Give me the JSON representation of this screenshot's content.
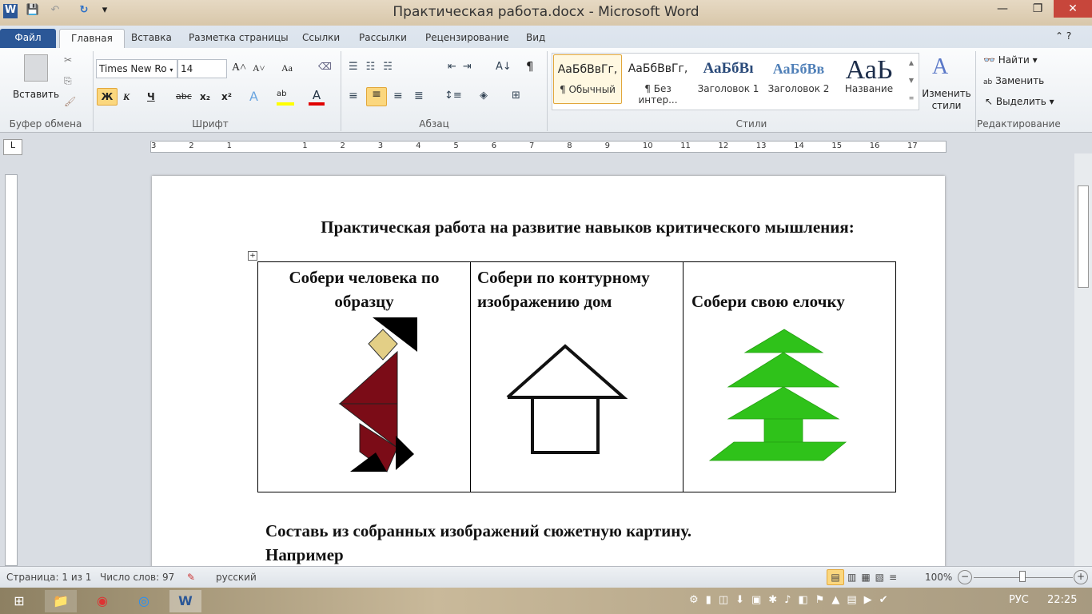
{
  "window": {
    "title": "Практическая работа.docx - Microsoft Word",
    "min": "—",
    "max": "❐",
    "close": "✕"
  },
  "quick_access": {
    "word_icon": "W",
    "save": "💾",
    "undo": "↶",
    "redo": "↻",
    "customize": "▾"
  },
  "tabs": [
    "Файл",
    "Главная",
    "Вставка",
    "Разметка страницы",
    "Ссылки",
    "Рассылки",
    "Рецензирование",
    "Вид"
  ],
  "ribbon": {
    "clipboard": {
      "paste": "Вставить",
      "label": "Буфер обмена"
    },
    "font": {
      "name": "Times New Ro",
      "size": "14",
      "bold": "Ж",
      "italic": "К",
      "underline": "Ч",
      "strike": "abc",
      "sub": "x₂",
      "sup": "x²",
      "grow": "A˄",
      "shrink": "A˅",
      "case": "Aa",
      "label": "Шрифт",
      "highlight_color": "#ffff00",
      "font_color": "#e00000"
    },
    "paragraph": {
      "label": "Абзац",
      "pilcrow": "¶"
    },
    "styles": {
      "label": "Стили",
      "items": [
        {
          "preview": "АаБбВвГг,",
          "name": "¶ Обычный"
        },
        {
          "preview": "АаБбВвГг,",
          "name": "¶ Без интер..."
        },
        {
          "preview": "АаБбВı",
          "name": "Заголовок 1"
        },
        {
          "preview": "АаБбВв",
          "name": "Заголовок 2"
        },
        {
          "preview": "АаЬ",
          "name": "Название"
        }
      ],
      "change": "Изменить стили"
    },
    "editing": {
      "label": "Редактирование",
      "find": "Найти",
      "replace": "Заменить",
      "select": "Выделить"
    }
  },
  "ruler": {
    "ticks": [
      "3",
      "2",
      "1",
      "",
      "1",
      "2",
      "3",
      "4",
      "5",
      "6",
      "7",
      "8",
      "9",
      "10",
      "11",
      "12",
      "13",
      "14",
      "15",
      "16",
      "17"
    ]
  },
  "document": {
    "heading": "Практическая работа на развитие навыков критического мышления:",
    "cells": [
      "Собери человека по образцу",
      "Собери по контурному изображению  дом",
      "Собери свою елочку"
    ],
    "para1": "Составь из собранных изображений сюжетную картину.",
    "para2": "Например",
    "colors": {
      "figure_body": "#7b0c17",
      "figure_head": "#e3cf86",
      "tree": "#2fc21a"
    }
  },
  "status": {
    "page": "Страница: 1 из 1",
    "words": "Число слов: 97",
    "language": "русский",
    "zoom": "100%",
    "zoom_percent": 100
  },
  "taskbar": {
    "lang": "РУС",
    "time": "22:25"
  }
}
